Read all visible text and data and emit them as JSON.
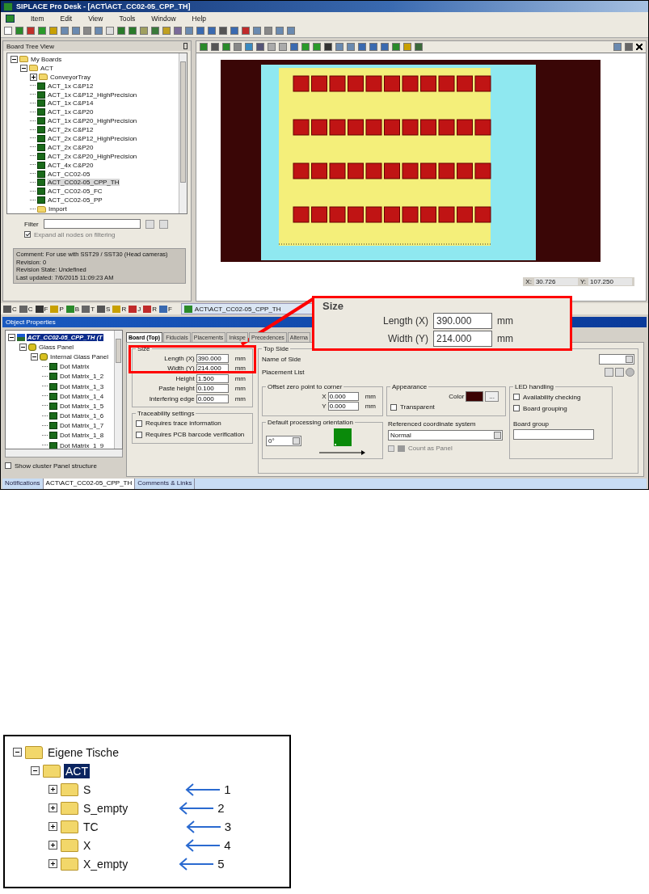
{
  "window": {
    "title": "SIPLACE Pro Desk - [ACT\\ACT_CC02-05_CPP_TH]"
  },
  "menu": [
    "Item",
    "Edit",
    "View",
    "Tools",
    "Window",
    "Help"
  ],
  "board_tree": {
    "title": "Board Tree View",
    "items": [
      {
        "label": "My Boards",
        "kind": "folder",
        "expanded": true,
        "children": [
          {
            "label": "ACT",
            "kind": "folder",
            "expanded": true,
            "children": [
              {
                "label": "ConveyorTray",
                "kind": "folder",
                "expanded": false
              },
              {
                "label": "ACT_1x C&P12",
                "kind": "board",
                "selected": false
              },
              {
                "label": "ACT_1x C&P12_HighPrecision",
                "kind": "board",
                "selected": false
              },
              {
                "label": "ACT_1x C&P14",
                "kind": "board",
                "selected": false
              },
              {
                "label": "ACT_1x C&P20",
                "kind": "board",
                "selected": false
              },
              {
                "label": "ACT_1x C&P20_HighPrecision",
                "kind": "board",
                "selected": false
              },
              {
                "label": "ACT_2x C&P12",
                "kind": "board",
                "selected": false
              },
              {
                "label": "ACT_2x C&P12_HighPrecision",
                "kind": "board",
                "selected": false
              },
              {
                "label": "ACT_2x C&P20",
                "kind": "board",
                "selected": false
              },
              {
                "label": "ACT_2x C&P20_HighPrecision",
                "kind": "board",
                "selected": false
              },
              {
                "label": "ACT_4x C&P20",
                "kind": "board",
                "selected": false
              },
              {
                "label": "ACT_CC02-05",
                "kind": "board",
                "selected": false
              },
              {
                "label": "ACT_CC02-05_CPP_TH",
                "kind": "board",
                "selected": true
              },
              {
                "label": "ACT_CC02-05_FC",
                "kind": "board",
                "selected": false
              },
              {
                "label": "ACT_CC02-05_PP",
                "kind": "board",
                "selected": false
              },
              {
                "label": "Import",
                "kind": "folder"
              }
            ]
          }
        ]
      }
    ],
    "filter_label": "Filter",
    "expand_on_filter": {
      "label": "Expand all nodes on filtering",
      "checked": true
    },
    "info": [
      "Comment: For use with SST29 / SST30 (Head cameras)",
      "Revision: 0",
      "Revision State: Undefined",
      "Last updated: 7/6/2015 11:09:23 AM"
    ]
  },
  "canvas": {
    "coords": [
      {
        "label": "X:",
        "value": "30.726"
      },
      {
        "label": "Y:",
        "value": "107.250"
      }
    ]
  },
  "dock_tabs": [
    {
      "label": "C"
    },
    {
      "label": "C"
    },
    {
      "label": "F"
    },
    {
      "label": "P"
    },
    {
      "label": "B"
    },
    {
      "label": "T"
    },
    {
      "label": "S"
    },
    {
      "label": "R"
    },
    {
      "label": "J"
    },
    {
      "label": "R"
    },
    {
      "label": "F"
    }
  ],
  "document_tab": "ACT\\ACT_CC02-05_CPP_TH",
  "object_properties": {
    "title": "Object Properties",
    "tree": [
      {
        "label": "ACT_CC02-05_CPP_TH (T",
        "kind": "root",
        "selected": true,
        "expanded": true,
        "children": [
          {
            "label": "Glass Panel",
            "kind": "panel",
            "selected": false,
            "expanded": true,
            "children": [
              {
                "label": "Internal Glass Panel",
                "kind": "panel",
                "selected": false,
                "expanded": true,
                "children": [
                  {
                    "label": "Dot Matrix",
                    "kind": "board",
                    "selected": false
                  },
                  {
                    "label": "Dot Matrix_1_2",
                    "kind": "board",
                    "selected": false
                  },
                  {
                    "label": "Dot Matrix_1_3",
                    "kind": "board",
                    "selected": false
                  },
                  {
                    "label": "Dot Matrix_1_4",
                    "kind": "board",
                    "selected": false
                  },
                  {
                    "label": "Dot Matrix_1_5",
                    "kind": "board",
                    "selected": false
                  },
                  {
                    "label": "Dot Matrix_1_6",
                    "kind": "board",
                    "selected": false
                  },
                  {
                    "label": "Dot Matrix_1_7",
                    "kind": "board",
                    "selected": false
                  },
                  {
                    "label": "Dot Matrix_1_8",
                    "kind": "board",
                    "selected": false
                  },
                  {
                    "label": "Dot Matrix_1_9",
                    "kind": "board",
                    "selected": false
                  }
                ]
              }
            ]
          }
        ]
      }
    ],
    "show_cluster": {
      "label": "Show cluster Panel structure",
      "checked": false
    },
    "tabs": [
      {
        "label": "Board (Top)",
        "selected": true
      },
      {
        "label": "Fiducials",
        "selected": false
      },
      {
        "label": "Placements",
        "selected": false
      },
      {
        "label": "Inkspe",
        "selected": false
      },
      {
        "label": "Precedences",
        "selected": false
      },
      {
        "label": "Alterna",
        "selected": false
      }
    ],
    "size": {
      "title": "Size",
      "fields": [
        {
          "label": "Length (X)",
          "value": "390.000",
          "unit": "mm"
        },
        {
          "label": "Width (Y)",
          "value": "214.000",
          "unit": "mm"
        },
        {
          "label": "Height",
          "value": "1.500",
          "unit": "mm"
        },
        {
          "label": "Paste height",
          "value": "0.100",
          "unit": "mm"
        },
        {
          "label": "Interfering edge",
          "value": "0.000",
          "unit": "mm"
        }
      ]
    },
    "traceability": {
      "title": "Traceability settings",
      "options": [
        {
          "label": "Requires trace information",
          "checked": false
        },
        {
          "label": "Requires PCB barcode verification",
          "checked": false
        }
      ]
    },
    "top_side": {
      "title": "Top Side",
      "name_label": "Name of Side",
      "list_label": "Placement List",
      "offset": {
        "title": "Offset zero point to corner",
        "fields": [
          {
            "label": "X",
            "value": "0.000",
            "unit": "mm"
          },
          {
            "label": "Y",
            "value": "0.000",
            "unit": "mm"
          }
        ]
      },
      "appearance": {
        "title": "Appearance",
        "color_label": "Color",
        "color": "#3b0303",
        "picker": "...",
        "transparent": {
          "label": "Transparent",
          "checked": false
        }
      },
      "led": {
        "title": "LED handling",
        "options": [
          {
            "label": "Availability checking",
            "checked": false
          },
          {
            "label": "Board grouping",
            "checked": false
          }
        ],
        "group_label": "Board group"
      },
      "orientation": {
        "title": "Default processing orientation",
        "value": "0°"
      },
      "coordinate": {
        "title": "Referenced coordinate system",
        "value": "Normal",
        "count_panel": {
          "label": "Count as Panel",
          "checked": false,
          "disabled": true
        }
      }
    },
    "bottom_tabs": [
      {
        "label": "Notifications",
        "selected": false
      },
      {
        "label": "ACT\\ACT_CC02-05_CPP_TH",
        "selected": true
      },
      {
        "label": "Comments & Links",
        "selected": false
      }
    ]
  },
  "callout": {
    "title": "Size",
    "fields": [
      {
        "label": "Length (X)",
        "value": "390.000",
        "unit": "mm"
      },
      {
        "label": "Width (Y)",
        "value": "214.000",
        "unit": "mm"
      }
    ]
  },
  "folder_tree": {
    "items": [
      {
        "label": "Eigene Tische",
        "expanded": true,
        "selected": false,
        "children": [
          {
            "label": "ACT",
            "expanded": true,
            "selected": true,
            "children": [
              {
                "label": "S",
                "expanded": false,
                "selected": false,
                "marker": "1"
              },
              {
                "label": "S_empty",
                "expanded": false,
                "selected": false,
                "marker": "2"
              },
              {
                "label": "TC",
                "expanded": false,
                "selected": false,
                "marker": "3"
              },
              {
                "label": "X",
                "expanded": false,
                "selected": false,
                "marker": "4"
              },
              {
                "label": "X_empty",
                "expanded": false,
                "selected": false,
                "marker": "5"
              }
            ]
          }
        ]
      }
    ]
  }
}
